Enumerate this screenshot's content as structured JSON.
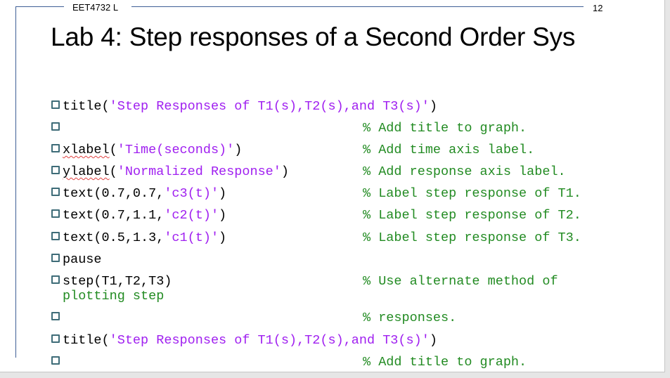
{
  "header": {
    "course_code": "EET4732 L",
    "page_number": "12"
  },
  "slide": {
    "title": "Lab 4: Step responses of a Second Order Sys"
  },
  "code_lines": [
    {
      "parts": [
        {
          "type": "kw",
          "text": "title("
        },
        {
          "type": "str",
          "text": "'Step Responses of T1(s),T2(s),and T3(s)'"
        },
        {
          "type": "kw",
          "text": ")"
        }
      ],
      "comment": ""
    },
    {
      "parts": [],
      "comment": "% Add title to graph."
    },
    {
      "parts": [
        {
          "type": "kw",
          "text": "xlabel",
          "spell": true
        },
        {
          "type": "kw",
          "text": "("
        },
        {
          "type": "str",
          "text": "'Time(seconds)'"
        },
        {
          "type": "kw",
          "text": ")"
        }
      ],
      "comment": "% Add time axis label."
    },
    {
      "parts": [
        {
          "type": "kw",
          "text": "ylabel",
          "spell": true
        },
        {
          "type": "kw",
          "text": "("
        },
        {
          "type": "str",
          "text": "'Normalized Response'"
        },
        {
          "type": "kw",
          "text": ")"
        }
      ],
      "comment": "% Add response axis label."
    },
    {
      "parts": [
        {
          "type": "kw",
          "text": "text(0.7,0.7,"
        },
        {
          "type": "str",
          "text": "'c3(t)'"
        },
        {
          "type": "kw",
          "text": ")"
        }
      ],
      "comment": "% Label step response of T1."
    },
    {
      "parts": [
        {
          "type": "kw",
          "text": "text(0.7,1.1,"
        },
        {
          "type": "str",
          "text": "'c2(t)'"
        },
        {
          "type": "kw",
          "text": ")"
        }
      ],
      "comment": "% Label step response of T2."
    },
    {
      "parts": [
        {
          "type": "kw",
          "text": "text(0.5,1.3,"
        },
        {
          "type": "str",
          "text": "'c1(t)'"
        },
        {
          "type": "kw",
          "text": ")"
        }
      ],
      "comment": "% Label step response of T3."
    },
    {
      "parts": [
        {
          "type": "kw",
          "text": "pause"
        }
      ],
      "comment": ""
    },
    {
      "parts": [
        {
          "type": "kw",
          "text": "step(T1,T2,T3)"
        }
      ],
      "comment": "% Use alternate method of",
      "wrap": "plotting step"
    },
    {
      "parts": [],
      "comment": "% responses."
    },
    {
      "parts": [
        {
          "type": "kw",
          "text": "title("
        },
        {
          "type": "str",
          "text": "'Step Responses of T1(s),T2(s),and T3(s)'"
        },
        {
          "type": "kw",
          "text": ")"
        }
      ],
      "comment": ""
    },
    {
      "parts": [],
      "comment": "% Add title to graph."
    }
  ],
  "colors": {
    "keyword": "#000000",
    "string": "#a020f0",
    "comment": "#228b22",
    "frame": "#3f5f96",
    "bullet": "#3e6c78"
  }
}
